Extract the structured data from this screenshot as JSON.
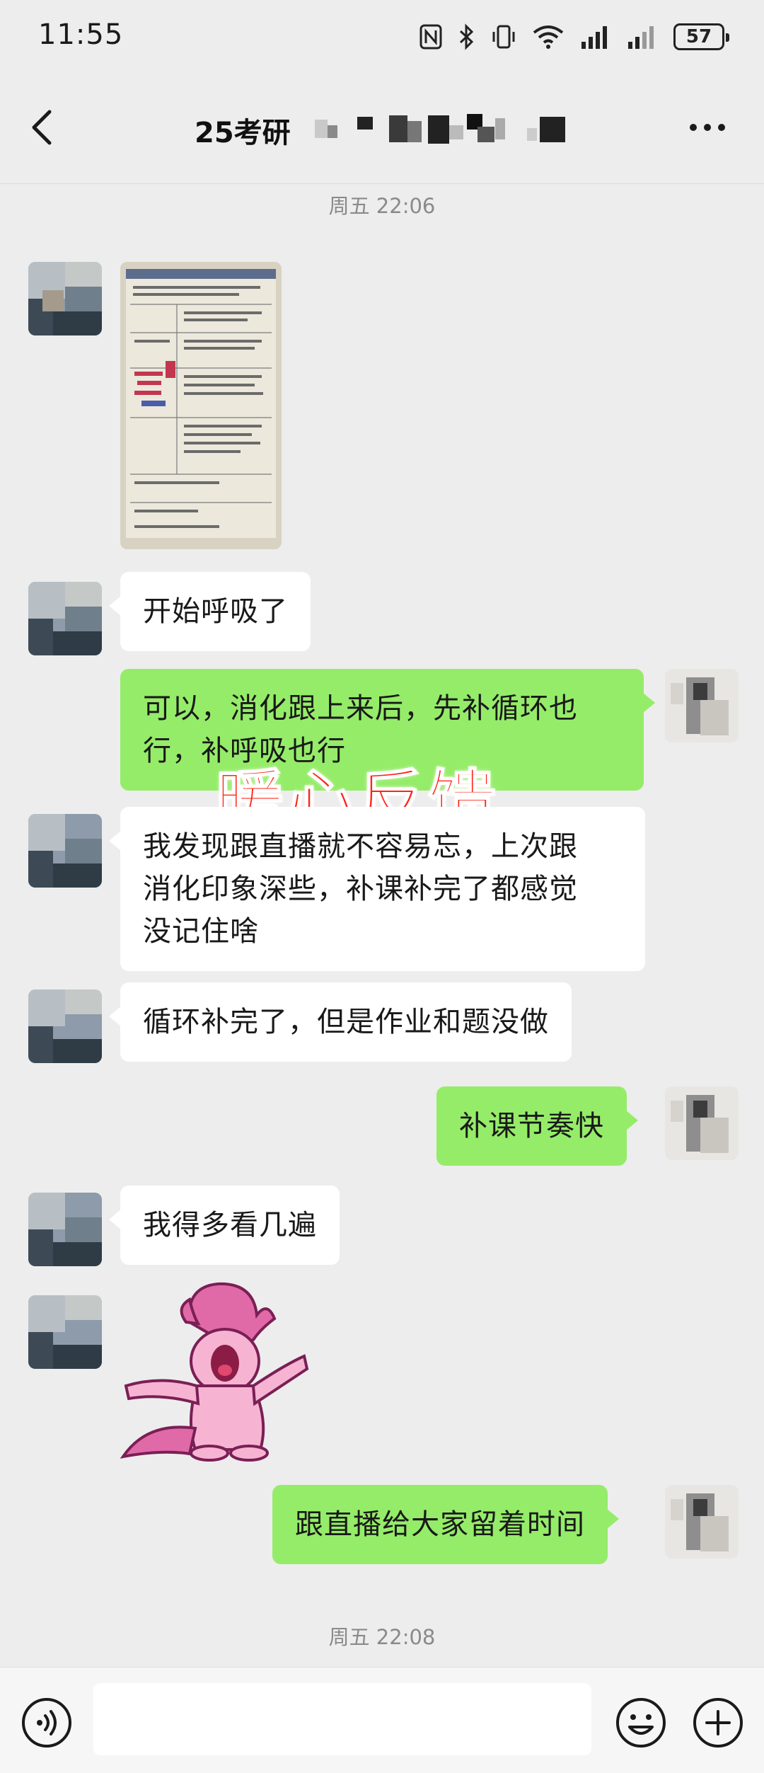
{
  "status_bar": {
    "time": "11:55",
    "battery": "57",
    "icons": [
      "nfc-icon",
      "bluetooth-icon",
      "vibrate-icon",
      "wifi-icon",
      "signal-icon",
      "signal-icon",
      "battery-icon"
    ]
  },
  "header": {
    "title": "25考研",
    "back_icon": "chevron-left-icon",
    "more_icon": "ellipsis-icon"
  },
  "messages": {
    "timestamp_1": "周五 22:06",
    "msg_1": "开始呼吸了",
    "msg_2_line1": "可以，消化跟上来后，先补循环也",
    "msg_2_line2": "行，补呼吸也行",
    "overlay_caption": "暖心反馈",
    "msg_3_line1": "我发现跟直播就不容易忘，上次跟",
    "msg_3_line2": "消化印象深些，补课补完了都感觉",
    "msg_3_line3": "没记住啥",
    "msg_4": "循环补完了，但是作业和题没做",
    "msg_5": "补课节奏快",
    "msg_6": "我得多看几遍",
    "msg_7": "跟直播给大家留着时间",
    "timestamp_2": "周五 22:08"
  },
  "input_bar": {
    "placeholder": "",
    "icons": [
      "voice-icon",
      "emoji-icon",
      "plus-icon"
    ]
  },
  "colors": {
    "background": "#ededed",
    "bubble_sent": "#95ec69",
    "bubble_received": "#ffffff",
    "overlay_text": "#ff2418"
  }
}
